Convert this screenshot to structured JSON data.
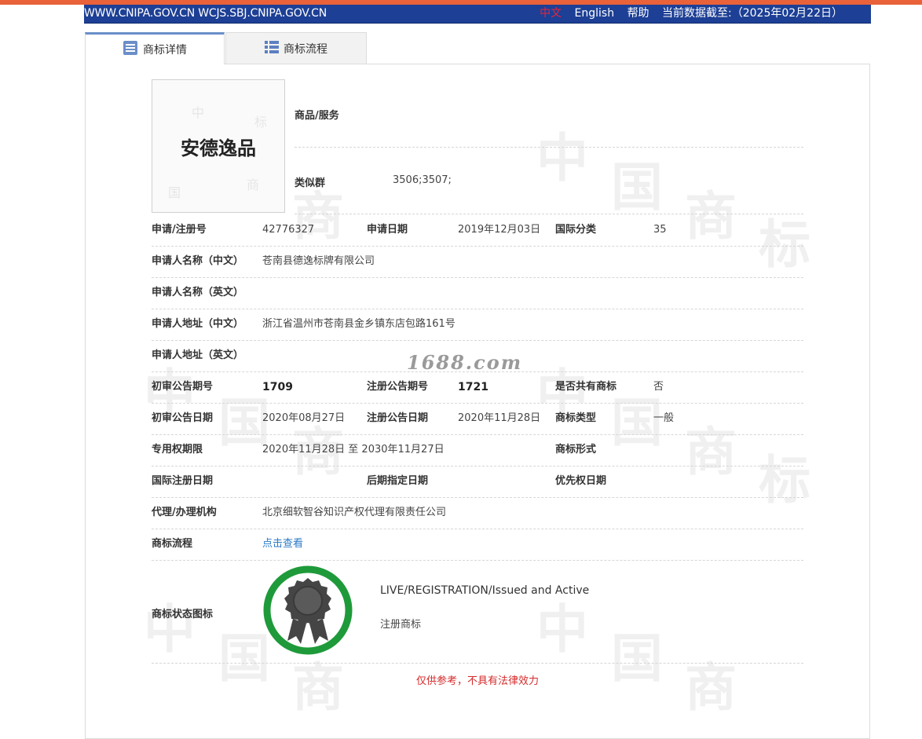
{
  "header": {
    "url": "WWW.CNIPA.GOV.CN WCJS.SBJ.CNIPA.GOV.CN",
    "lang_zh": "中文",
    "lang_en": "English",
    "help": "帮助",
    "data_date": "当前数据截至:（2025年02月22日）"
  },
  "tabs": {
    "details": "商标详情",
    "process": "商标流程"
  },
  "mark": {
    "image_text": "安德逸品"
  },
  "goods": {
    "label": "商品/服务",
    "similar_label": "类似群",
    "similar_value": "3506;3507;"
  },
  "fields": {
    "reg_no_label": "申请/注册号",
    "reg_no": "42776327",
    "app_date_label": "申请日期",
    "app_date": "2019年12月03日",
    "intl_class_label": "国际分类",
    "intl_class": "35",
    "applicant_cn_label": "申请人名称（中文）",
    "applicant_cn": "苍南县德逸标牌有限公司",
    "applicant_en_label": "申请人名称（英文）",
    "applicant_en": "",
    "address_cn_label": "申请人地址（中文）",
    "address_cn": "浙江省温州市苍南县金乡镇东店包路161号",
    "address_en_label": "申请人地址（英文）",
    "address_en": "",
    "prelim_no_label": "初审公告期号",
    "prelim_no": "1709",
    "reg_pub_no_label": "注册公告期号",
    "reg_pub_no": "1721",
    "shared_label": "是否共有商标",
    "shared": "否",
    "prelim_date_label": "初审公告日期",
    "prelim_date": "2020年08月27日",
    "reg_pub_date_label": "注册公告日期",
    "reg_pub_date": "2020年11月28日",
    "mark_type_label": "商标类型",
    "mark_type": "一般",
    "term_label": "专用权期限",
    "term": "2020年11月28日 至 2030年11月27日",
    "mark_form_label": "商标形式",
    "intl_reg_date_label": "国际注册日期",
    "later_date_label": "后期指定日期",
    "priority_date_label": "优先权日期",
    "agent_label": "代理/办理机构",
    "agent": "北京细软智谷知识产权代理有限责任公司",
    "process_label": "商标流程",
    "process_link": "点击查看"
  },
  "status": {
    "label": "商标状态图标",
    "en": "LIVE/REGISTRATION/Issued and Active",
    "zh": "注册商标",
    "ring_color": "#1f9a3a"
  },
  "disclaimer": "仅供参考，不具有法律效力",
  "site_watermark": "1688.com",
  "watermark_chars": [
    "中",
    "国",
    "商",
    "标"
  ],
  "colors": {
    "header_bg": "#1d3f95",
    "top_stripe": "#e9623a",
    "link": "#2a7ac7",
    "disclaimer": "#d42a2a"
  }
}
